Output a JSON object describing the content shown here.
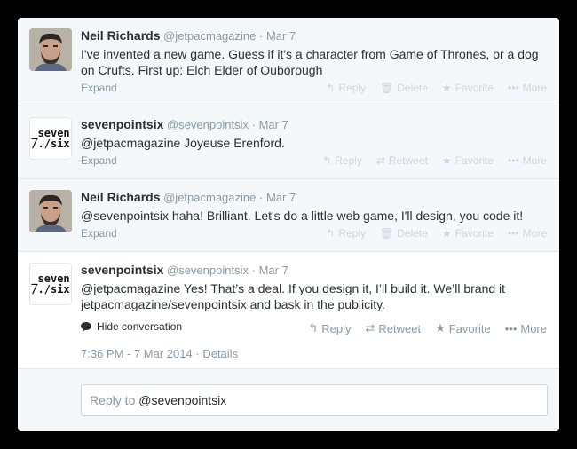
{
  "tweets": [
    {
      "name": "Neil Richards",
      "handle": "@jetpacmagazine",
      "sep": "·",
      "time": "Mar 7",
      "text": "I've invented a new game. Guess if it's a character from Game of Thrones, or a dog on Crufts. First up: Elch Elder of Ouborough",
      "expand": "Expand",
      "actions": [
        "Reply",
        "Delete",
        "Favorite",
        "More"
      ]
    },
    {
      "name": "sevenpointsix",
      "handle": "@sevenpointsix",
      "sep": "·",
      "time": "Mar 7",
      "text": "@jetpacmagazine Joyeuse Erenford.",
      "expand": "Expand",
      "actions": [
        "Reply",
        "Retweet",
        "Favorite",
        "More"
      ]
    },
    {
      "name": "Neil Richards",
      "handle": "@jetpacmagazine",
      "sep": "·",
      "time": "Mar 7",
      "text": "@sevenpointsix haha! Brilliant. Let's do a little web game, I'll design,  you code it!",
      "expand": "Expand",
      "actions": [
        "Reply",
        "Delete",
        "Favorite",
        "More"
      ]
    },
    {
      "name": "sevenpointsix",
      "handle": "@sevenpointsix",
      "sep": "·",
      "time": "Mar 7",
      "text": "@jetpacmagazine Yes! That’s a deal. If you design it, I’ll build it. We’ll brand it jetpacmagazine/sevenpointsix and bask in the publicity.",
      "hide_conversation": "Hide conversation",
      "actions": [
        "Reply",
        "Retweet",
        "Favorite",
        "More"
      ],
      "timestamp": "7:36 PM - 7 Mar 2014",
      "details": "Details"
    }
  ],
  "logo": {
    "line1": "_seven",
    "line2": "/./six"
  },
  "reply": {
    "prefix": "Reply to ",
    "mention": "@sevenpointsix"
  },
  "colors": {
    "name": "#292f33",
    "muted": "#8899a6",
    "faint": "#ccd6dd",
    "background": "#f5f8fa"
  }
}
